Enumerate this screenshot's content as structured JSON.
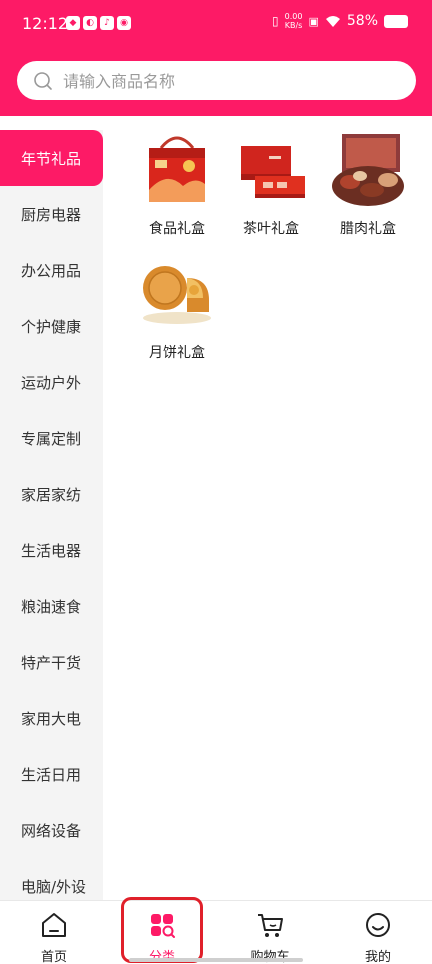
{
  "status": {
    "time": "12:12",
    "netspeed_value": "0.00",
    "netspeed_unit": "KB/s",
    "battery": "58%"
  },
  "search": {
    "placeholder": "请输入商品名称"
  },
  "sidebar": {
    "items": [
      {
        "label": "年节礼品",
        "active": true
      },
      {
        "label": "厨房电器"
      },
      {
        "label": "办公用品"
      },
      {
        "label": "个护健康"
      },
      {
        "label": "运动户外"
      },
      {
        "label": "专属定制"
      },
      {
        "label": "家居家纺"
      },
      {
        "label": "生活电器"
      },
      {
        "label": "粮油速食"
      },
      {
        "label": "特产干货"
      },
      {
        "label": "家用大电"
      },
      {
        "label": "生活日用"
      },
      {
        "label": "网络设备"
      },
      {
        "label": "电脑/外设"
      }
    ]
  },
  "products": [
    {
      "label": "食品礼盒",
      "icon": "gift-box-image"
    },
    {
      "label": "茶叶礼盒",
      "icon": "tea-box-image"
    },
    {
      "label": "腊肉礼盒",
      "icon": "cured-meat-image"
    },
    {
      "label": "月饼礼盒",
      "icon": "mooncake-image"
    }
  ],
  "tabbar": {
    "tabs": [
      {
        "label": "首页",
        "icon": "home-icon"
      },
      {
        "label": "分类",
        "icon": "category-icon",
        "active": true
      },
      {
        "label": "购物车",
        "icon": "cart-icon"
      },
      {
        "label": "我的",
        "icon": "profile-icon"
      }
    ]
  },
  "colors": {
    "brand": "#fd1a66",
    "highlight": "#e0202a"
  }
}
